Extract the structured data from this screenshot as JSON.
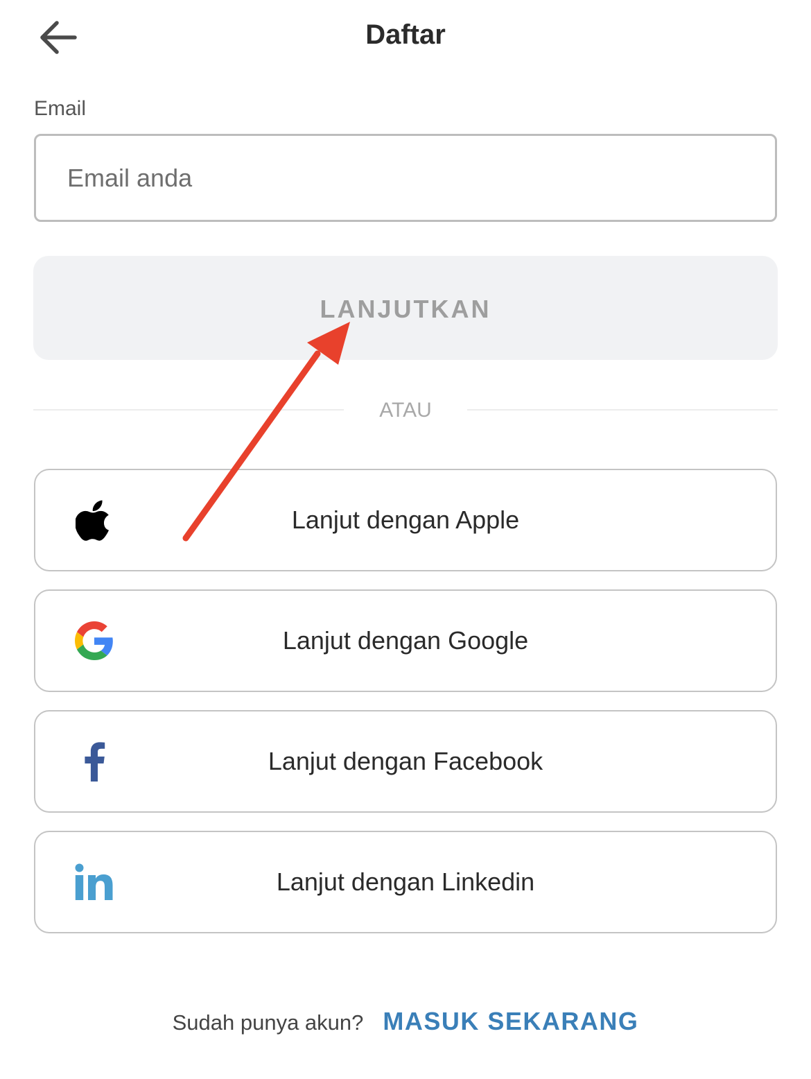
{
  "header": {
    "title": "Daftar",
    "back_icon": "arrow-left-icon"
  },
  "email": {
    "label": "Email",
    "placeholder": "Email anda",
    "value": ""
  },
  "continue_button": {
    "label": "LANJUTKAN"
  },
  "divider": {
    "text": "ATAU"
  },
  "social": {
    "apple": {
      "label": "Lanjut dengan Apple",
      "icon": "apple-icon"
    },
    "google": {
      "label": "Lanjut dengan Google",
      "icon": "google-icon"
    },
    "facebook": {
      "label": "Lanjut dengan Facebook",
      "icon": "facebook-icon"
    },
    "linkedin": {
      "label": "Lanjut dengan Linkedin",
      "icon": "linkedin-icon"
    }
  },
  "footer": {
    "prompt": "Sudah punya akun?",
    "link": "MASUK SEKARANG"
  },
  "colors": {
    "link": "#3a7fb8",
    "annotation_arrow": "#e8412c",
    "facebook": "#3b5998",
    "linkedin": "#4a9fd0"
  }
}
